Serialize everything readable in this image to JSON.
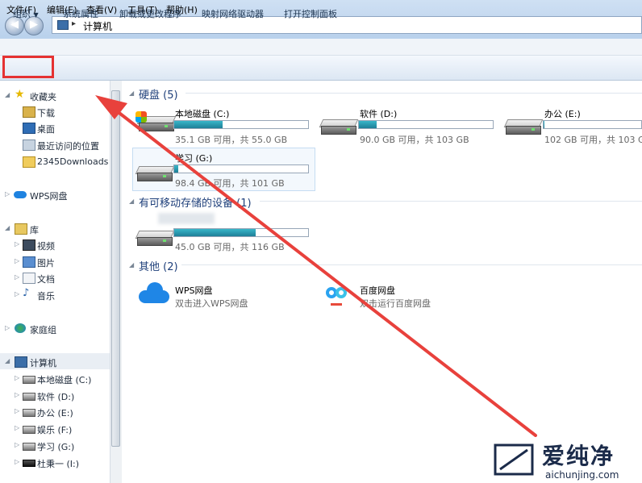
{
  "address": {
    "path": "计算机"
  },
  "menu": [
    "文件(F)",
    "编辑(E)",
    "查看(V)",
    "工具(T)",
    "帮助(H)"
  ],
  "toolbar": {
    "organize": "组织",
    "items": [
      "系统属性",
      "卸载或更改程序",
      "映射网络驱动器",
      "打开控制面板"
    ]
  },
  "nav": {
    "favorites": "收藏夹",
    "fav_items": [
      "下载",
      "桌面",
      "最近访问的位置",
      "2345Downloads"
    ],
    "wps": "WPS网盘",
    "library": "库",
    "lib_items": [
      "视频",
      "图片",
      "文档",
      "音乐"
    ],
    "homegroup": "家庭组",
    "computer": "计算机",
    "drives": [
      "本地磁盘 (C:)",
      "软件 (D:)",
      "办公 (E:)",
      "娱乐 (F:)",
      "学习 (G:)",
      "杜秉一 (I:)"
    ]
  },
  "content": {
    "hdd_header": "硬盘 (5)",
    "drives": [
      {
        "name": "本地磁盘 (C:)",
        "info": "35.1 GB 可用，共 55.0 GB",
        "used": 0.36
      },
      {
        "name": "软件 (D:)",
        "info": "90.0 GB 可用，共 103 GB",
        "used": 0.13
      },
      {
        "name": "办公 (E:)",
        "info": "102 GB 可用，共 103 GB",
        "used": 0.01
      },
      {
        "name": "学习 (G:)",
        "info": "98.4 GB 可用，共 101 GB",
        "used": 0.03
      }
    ],
    "removable_header": "有可移动存储的设备 (1)",
    "removable": {
      "info": "45.0 GB 可用，共 116 GB",
      "used": 0.61
    },
    "other_header": "其他 (2)",
    "others": [
      {
        "name": "WPS网盘",
        "desc": "双击进入WPS网盘"
      },
      {
        "name": "百度网盘",
        "desc": "双击运行百度网盘"
      }
    ]
  },
  "watermark": {
    "brand": "爱纯净",
    "url": "aichunjing.com"
  },
  "colors": {
    "highlight": "#e53232",
    "bar_fill": "#2a9bb3",
    "header": "#1e3f7a"
  }
}
